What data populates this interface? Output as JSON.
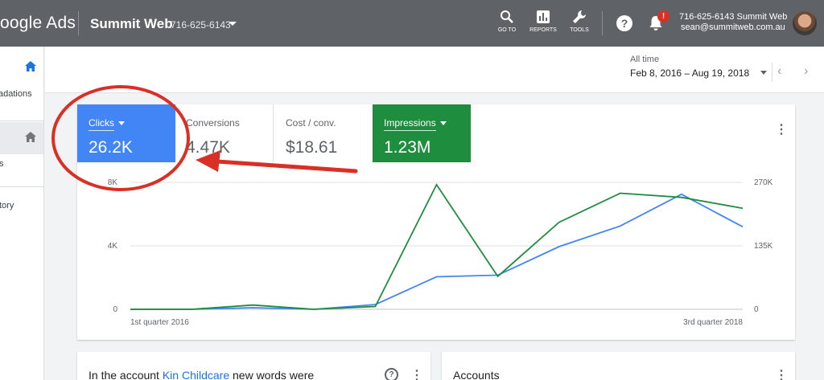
{
  "topbar": {
    "logo_text": "oogle Ads",
    "account_name": "Summit Web",
    "account_id": "716-625-6143",
    "tools": [
      {
        "label": "GO TO",
        "icon": "search-icon"
      },
      {
        "label": "REPORTS",
        "icon": "reports-icon"
      },
      {
        "label": "TOOLS",
        "icon": "wrench-icon"
      }
    ],
    "help_glyph": "?",
    "notification_badge": "!",
    "user_account": "716-625-6143 Summit Web",
    "user_email": "sean@summitweb.com.au"
  },
  "sidebar": {
    "items": [
      "adations",
      "s",
      "tory"
    ]
  },
  "date": {
    "label": "All time",
    "range": "Feb 8, 2016 – Aug 19, 2018",
    "prev_glyph": "‹",
    "next_glyph": "›"
  },
  "metrics": [
    {
      "label": "Clicks",
      "value": "26.2K",
      "color": "#4285f4"
    },
    {
      "label": "Conversions",
      "value": "4.47K"
    },
    {
      "label": "Cost / conv.",
      "value": "$18.61"
    },
    {
      "label": "Impressions",
      "value": "1.23M",
      "color": "#1e8e3e"
    }
  ],
  "chart_data": {
    "type": "line",
    "x_start_label": "1st quarter 2016",
    "x_end_label": "3rd quarter 2018",
    "left_axis": {
      "ticks": [
        "0",
        "4K",
        "8K"
      ],
      "ylim": [
        0,
        8000
      ]
    },
    "right_axis": {
      "ticks": [
        "0",
        "135K",
        "270K"
      ],
      "ylim": [
        0,
        270000
      ]
    },
    "grid": true,
    "series": [
      {
        "name": "Clicks",
        "axis": "left",
        "color": "#4285f4",
        "values": [
          0,
          0,
          100,
          0,
          300,
          2050,
          2150,
          3950,
          5250,
          7250,
          5200
        ]
      },
      {
        "name": "Impressions",
        "axis": "right",
        "color": "#1e8e3e",
        "values": [
          0,
          0,
          9000,
          0,
          6000,
          265000,
          70000,
          185000,
          247000,
          238000,
          215000
        ]
      }
    ]
  },
  "cards": {
    "insight_prefix": "In the account ",
    "insight_link": "Kin Childcare",
    "insight_suffix": " new words were",
    "insight_help": "?",
    "accounts_title": "Accounts"
  },
  "kebab_glyph": "⋮",
  "colors": {
    "topbar": "#5f6368",
    "annotation": "#d93025"
  }
}
